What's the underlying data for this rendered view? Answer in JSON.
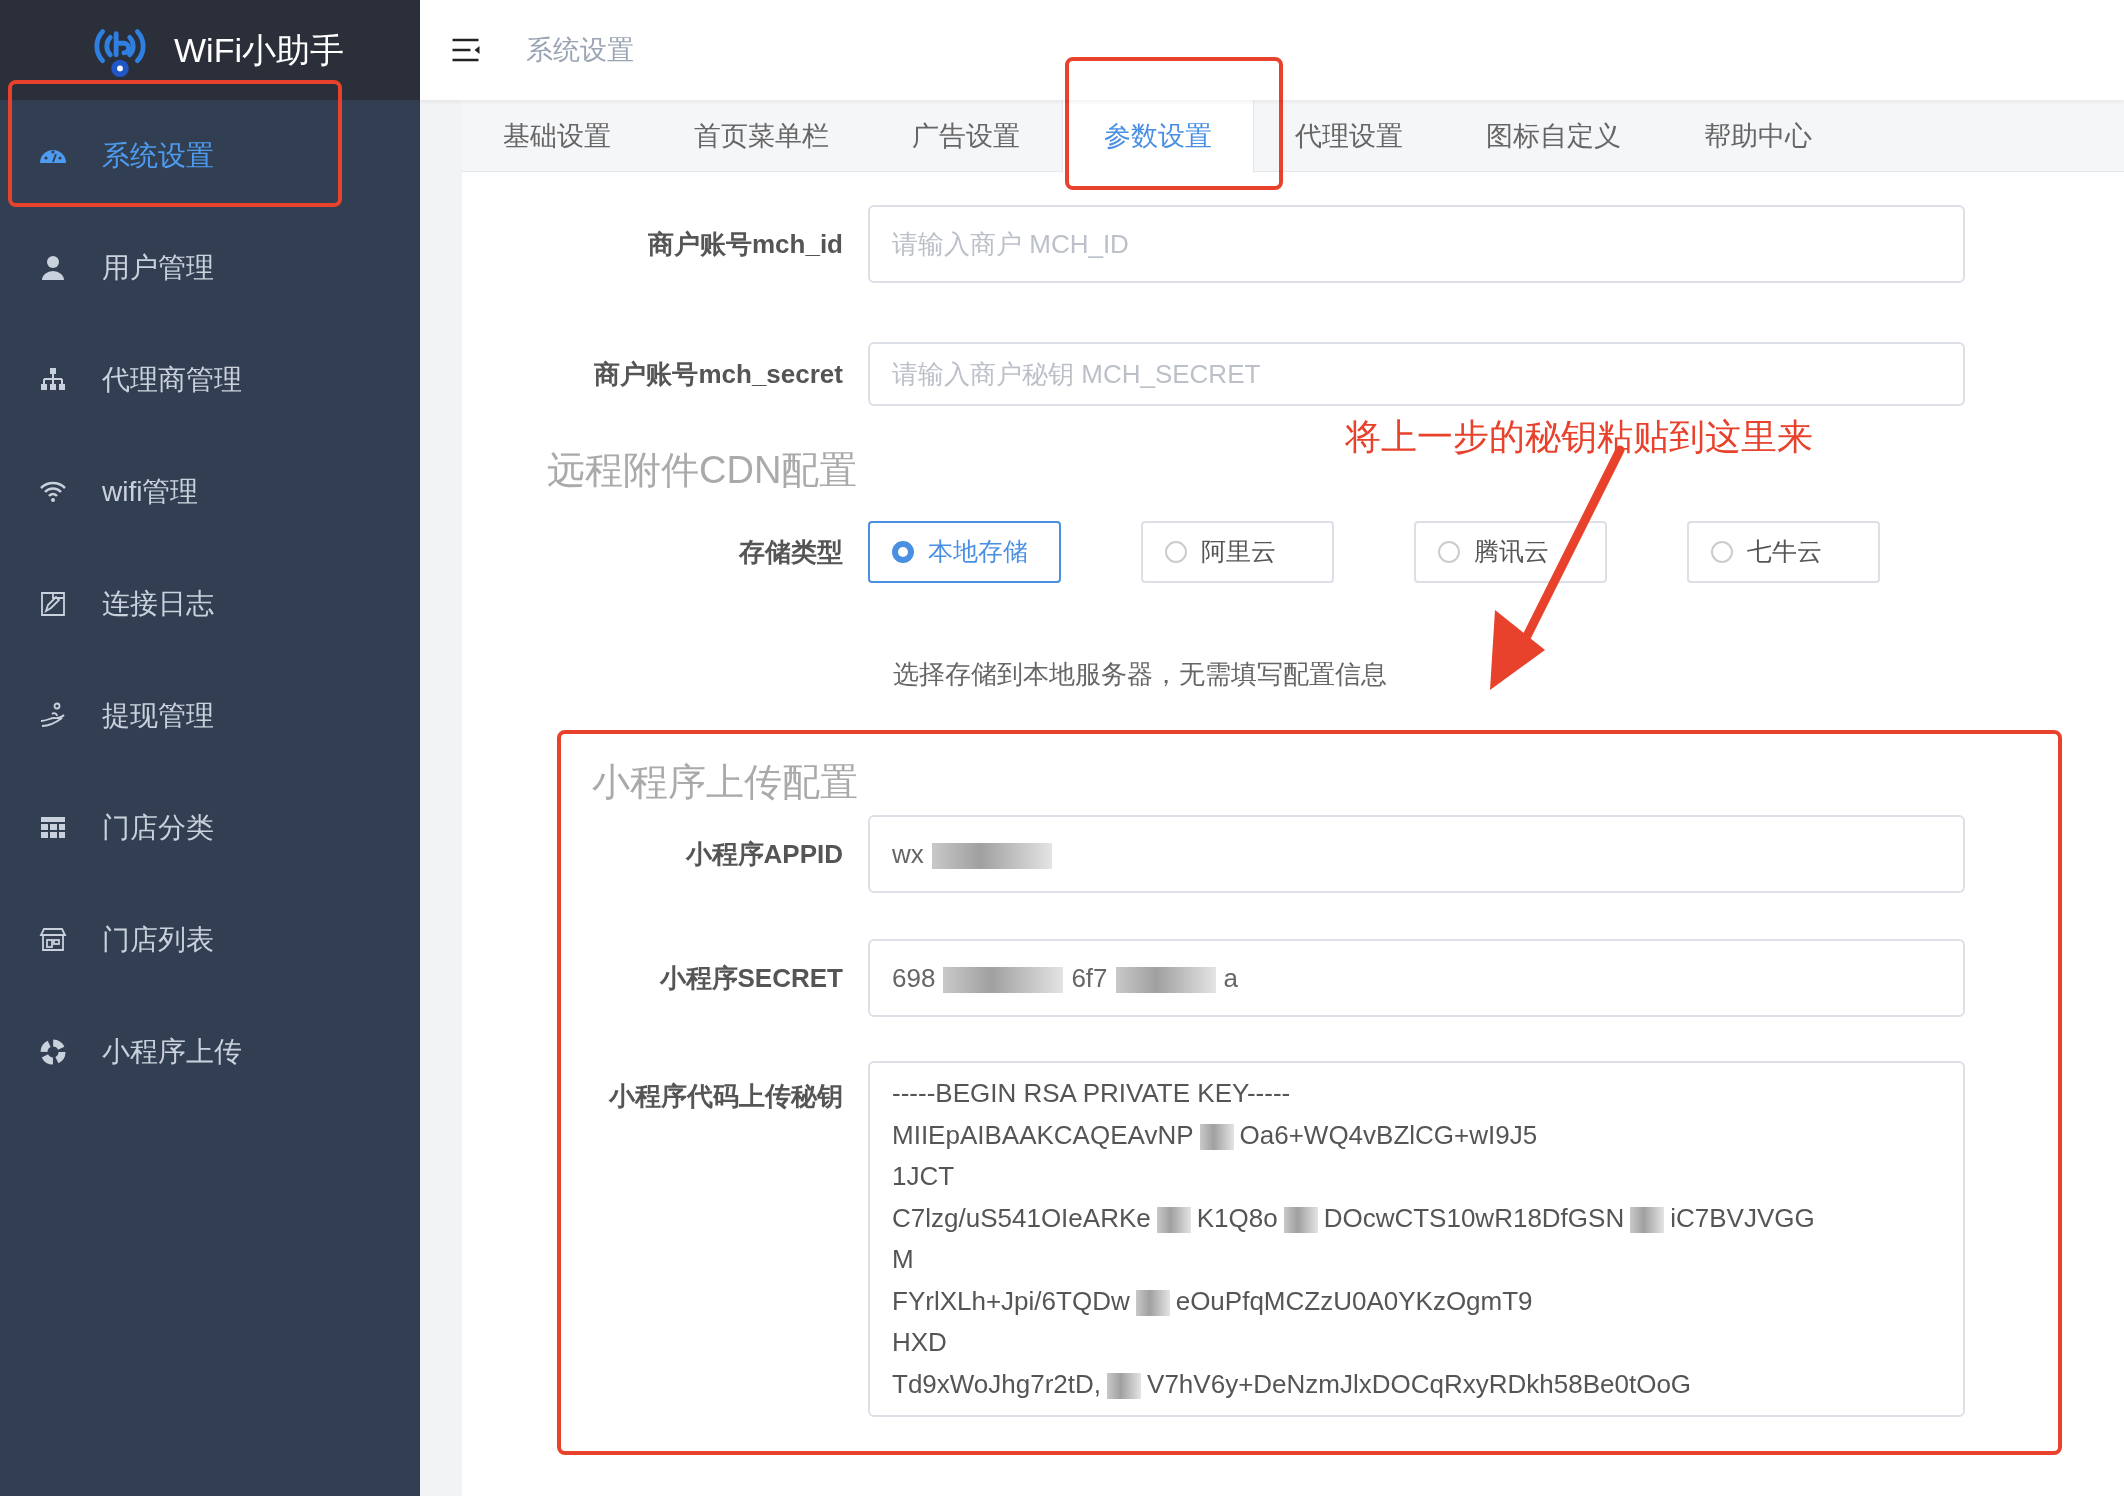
{
  "sidebar": {
    "logo_text": "WiFi小助手",
    "items": [
      {
        "label": "系统设置",
        "selected": true
      },
      {
        "label": "用户管理",
        "selected": false
      },
      {
        "label": "代理商管理",
        "selected": false
      },
      {
        "label": "wifi管理",
        "selected": false
      },
      {
        "label": "连接日志",
        "selected": false
      },
      {
        "label": "提现管理",
        "selected": false
      },
      {
        "label": "门店分类",
        "selected": false
      },
      {
        "label": "门店列表",
        "selected": false
      },
      {
        "label": "小程序上传",
        "selected": false
      }
    ]
  },
  "header": {
    "breadcrumb": "系统设置"
  },
  "tabs": [
    {
      "label": "基础设置",
      "selected": false
    },
    {
      "label": "首页菜单栏",
      "selected": false
    },
    {
      "label": "广告设置",
      "selected": false
    },
    {
      "label": "参数设置",
      "selected": true
    },
    {
      "label": "代理设置",
      "selected": false
    },
    {
      "label": "图标自定义",
      "selected": false
    },
    {
      "label": "帮助中心",
      "selected": false
    }
  ],
  "fields": [
    {
      "label": "商户账号mch_id",
      "placeholder": "请输入商户 MCH_ID"
    },
    {
      "label": "商户账号mch_secret",
      "placeholder": "请输入商户秘钥 MCH_SECRET"
    }
  ],
  "annotation": "将上一步的秘钥粘贴到这里来",
  "cdn": {
    "title": "远程附件CDN配置",
    "storage_label": "存储类型",
    "options": [
      {
        "label": "本地存储",
        "selected": true
      },
      {
        "label": "阿里云",
        "selected": false
      },
      {
        "label": "腾讯云",
        "selected": false
      },
      {
        "label": "七牛云",
        "selected": false
      }
    ],
    "help": "选择存储到本地服务器，无需填写配置信息"
  },
  "upload": {
    "title": "小程序上传配置",
    "appid": {
      "label": "小程序APPID",
      "value_parts": [
        "wx"
      ]
    },
    "secret": {
      "label": "小程序SECRET",
      "value_parts": [
        "698",
        "6f7",
        "a"
      ]
    },
    "key": {
      "label": "小程序代码上传秘钥",
      "lines": [
        [
          "-----BEGIN RSA PRIVATE KEY-----"
        ],
        [
          "MIIEpAIBAAKCAQEAvNP",
          "Oa6+WQ4vBZlCG+wI9J5"
        ],
        [
          "1JCT"
        ],
        [
          "C7lzg/uS541OIeARKe",
          "K1Q8o",
          "DOcwCTS10wR18DfGSN",
          "iC7BVJVGG"
        ],
        [
          "M"
        ],
        [
          "FYrlXLh+Jpi/6TQDw",
          "eOuPfqMCZzU0A0YKzOgmT9"
        ],
        [
          "HXD"
        ],
        [
          "Td9xWoJhg7r2tD,",
          "V7hV6y+DeNzmJlxDOCqRxyRDkh58Be0tOoG"
        ]
      ]
    }
  }
}
